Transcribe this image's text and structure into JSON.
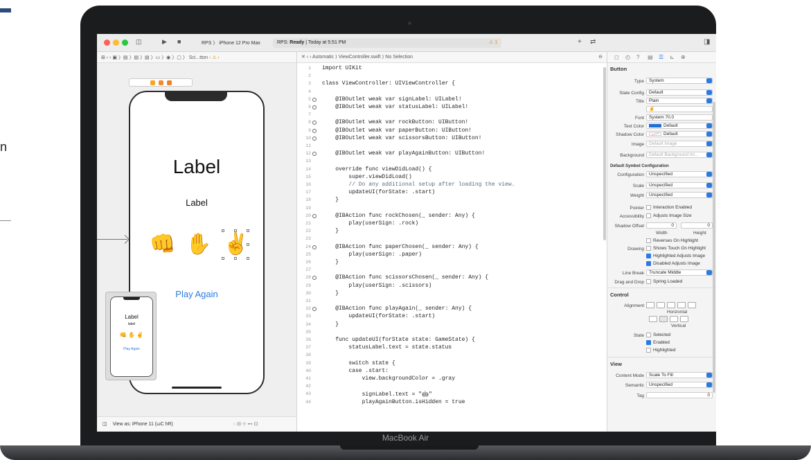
{
  "window": {
    "scheme": "RPS",
    "device": "iPhone 12 Pro Max",
    "status_prefix": "RPS:",
    "status_state": "Ready",
    "status_rest": "| Today at 5:51 PM",
    "warnings": "1"
  },
  "left_jumpbar": {
    "path": "Sci...tton"
  },
  "editor_jumpbar": {
    "path": "Automatic ⟩ ViewController.swift ⟩ No Selection"
  },
  "canvas": {
    "big_label": "Label",
    "small_label": "Label",
    "rock_emoji": "👊",
    "paper_emoji": "✋",
    "scissors_emoji": "✌️",
    "play_again": "Play Again",
    "mini_big_label": "Label",
    "mini_small_label": "label",
    "mini_emojis": "👊 ✋ ✌️",
    "mini_play": "Play Again",
    "view_as": "View as: iPhone 11 (ωC hR)"
  },
  "code_lines": [
    {
      "n": "1",
      "t": "import UIKit"
    },
    {
      "n": "2",
      "t": ""
    },
    {
      "n": "3",
      "t": "class ViewController: UIViewController {"
    },
    {
      "n": "4",
      "t": ""
    },
    {
      "n": "5",
      "t": "    @IBOutlet weak var signLabel: UILabel!"
    },
    {
      "n": "6",
      "t": "    @IBOutlet weak var statusLabel: UILabel!"
    },
    {
      "n": "7",
      "t": ""
    },
    {
      "n": "8",
      "t": "    @IBOutlet weak var rockButton: UIButton!"
    },
    {
      "n": "9",
      "t": "    @IBOutlet weak var paperButton: UIButton!"
    },
    {
      "n": "10",
      "t": "    @IBOutlet weak var scissorsButton: UIButton!"
    },
    {
      "n": "11",
      "t": ""
    },
    {
      "n": "12",
      "t": "    @IBOutlet weak var playAgainButton: UIButton!"
    },
    {
      "n": "13",
      "t": ""
    },
    {
      "n": "14",
      "t": "    override func viewDidLoad() {"
    },
    {
      "n": "15",
      "t": "        super.viewDidLoad()"
    },
    {
      "n": "16",
      "t": "        // Do any additional setup after loading the view."
    },
    {
      "n": "17",
      "t": "        updateUI(forState: .start)"
    },
    {
      "n": "18",
      "t": "    }"
    },
    {
      "n": "19",
      "t": ""
    },
    {
      "n": "20",
      "t": "    @IBAction func rockChosen(_ sender: Any) {"
    },
    {
      "n": "21",
      "t": "        play(userSign: .rock)"
    },
    {
      "n": "22",
      "t": "    }"
    },
    {
      "n": "23",
      "t": ""
    },
    {
      "n": "24",
      "t": "    @IBAction func paperChosen(_ sender: Any) {"
    },
    {
      "n": "25",
      "t": "        play(userSign: .paper)"
    },
    {
      "n": "26",
      "t": "    }"
    },
    {
      "n": "27",
      "t": ""
    },
    {
      "n": "28",
      "t": "    @IBAction func scissorsChosen(_ sender: Any) {"
    },
    {
      "n": "29",
      "t": "        play(userSign: .scissors)"
    },
    {
      "n": "30",
      "t": "    }"
    },
    {
      "n": "31",
      "t": ""
    },
    {
      "n": "32",
      "t": "    @IBAction func playAgain(_ sender: Any) {"
    },
    {
      "n": "33",
      "t": "        updateUI(forState: .start)"
    },
    {
      "n": "34",
      "t": "    }"
    },
    {
      "n": "35",
      "t": ""
    },
    {
      "n": "36",
      "t": "    func updateUI(forState state: GameState) {"
    },
    {
      "n": "37",
      "t": "        statusLabel.text = state.status"
    },
    {
      "n": "38",
      "t": ""
    },
    {
      "n": "39",
      "t": "        switch state {"
    },
    {
      "n": "40",
      "t": "        case .start:"
    },
    {
      "n": "41",
      "t": "            view.backgroundColor = .gray"
    },
    {
      "n": "42",
      "t": ""
    },
    {
      "n": "43",
      "t": "            signLabel.text = \"🤖\""
    },
    {
      "n": "44",
      "t": "            playAgainButton.isHidden = true"
    }
  ],
  "inspector": {
    "button_section": "Button",
    "type_label": "Type",
    "type_value": "System",
    "state_config_label": "State Config",
    "state_config_value": "Default",
    "title_label": "Title",
    "title_value": "Plain",
    "title_text": "✌️",
    "font_label": "Font",
    "font_value": "System 70.0",
    "text_color_label": "Text Color",
    "text_color_value": "Default",
    "shadow_color_label": "Shadow Color",
    "shadow_color_value": "Default",
    "image_label": "Image",
    "image_placeholder": "Default Image",
    "background_label": "Background",
    "background_placeholder": "Default Background Im...",
    "symbol_section": "Default Symbol Configuration",
    "configuration_label": "Configuration",
    "configuration_value": "Unspecified",
    "scale_label": "Scale",
    "scale_value": "Unspecified",
    "weight_label": "Weight",
    "weight_value": "Unspecified",
    "pointer_label": "Pointer",
    "pointer_check": "Interaction Enabled",
    "accessibility_label": "Accessibility",
    "accessibility_check": "Adjusts Image Size",
    "shadow_offset_label": "Shadow Offset",
    "shadow_w": "0",
    "shadow_h": "0",
    "width_label": "Width",
    "height_label": "Height",
    "reverses": "Reverses On Highlight",
    "drawing_label": "Drawing",
    "shows_touch": "Shows Touch On Highlight",
    "highlighted_adjusts": "Highlighted Adjusts Image",
    "disabled_adjusts": "Disabled Adjusts Image",
    "line_break_label": "Line Break",
    "line_break_value": "Truncate Middle",
    "drag_drop_label": "Drag and Drop",
    "spring_loaded": "Spring Loaded",
    "control_section": "Control",
    "alignment_label": "Alignment",
    "horizontal": "Horizontal",
    "vertical": "Vertical",
    "state_label": "State",
    "selected": "Selected",
    "enabled": "Enabled",
    "highlighted": "Highlighted",
    "view_section": "View",
    "content_mode_label": "Content Mode",
    "content_mode_value": "Scale To Fill",
    "semantic_label": "Semantic",
    "semantic_value": "Unspecified",
    "tag_label": "Tag",
    "tag_value": "0"
  },
  "device_brand": "MacBook Air",
  "side_text": "n"
}
